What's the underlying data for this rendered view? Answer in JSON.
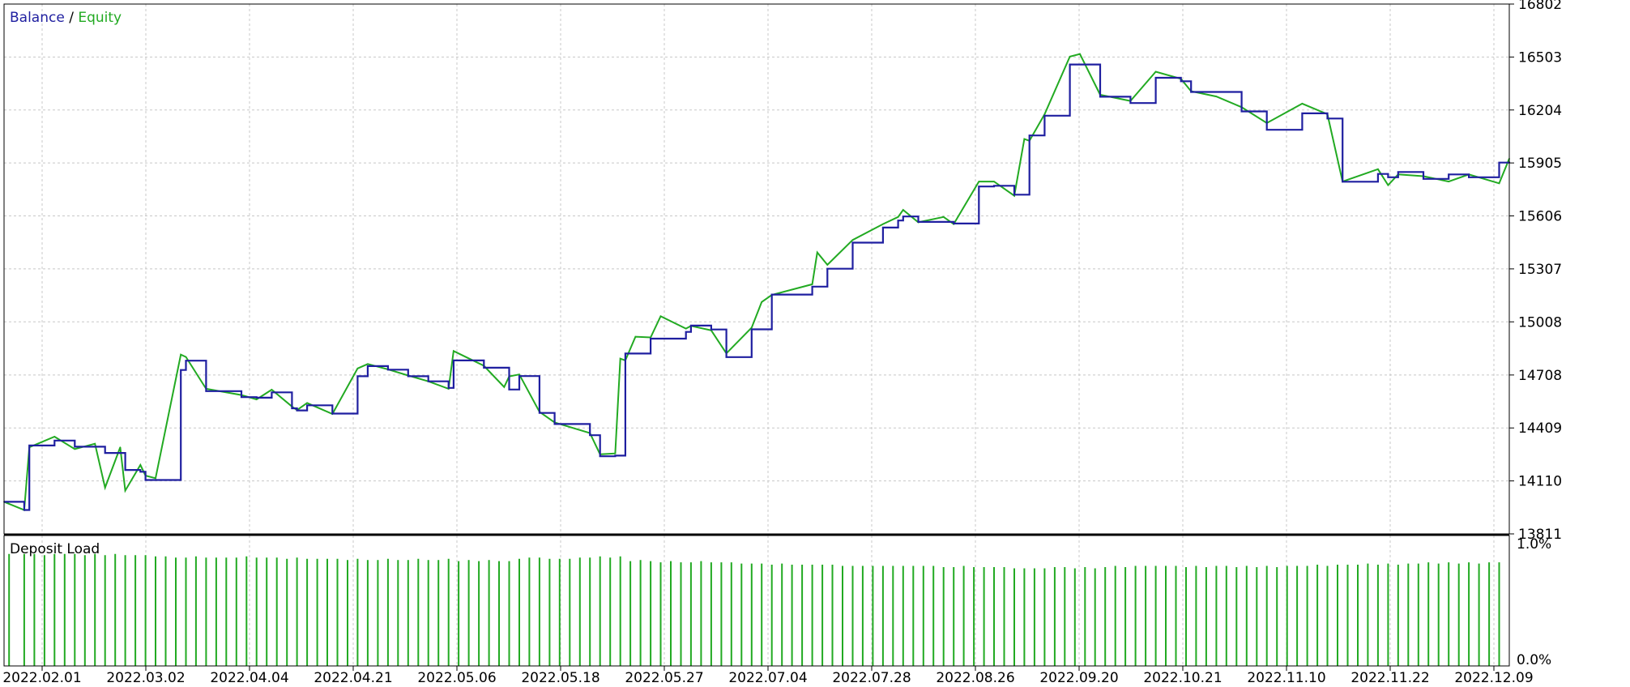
{
  "colors": {
    "balance": "#1F1FA0",
    "equity": "#22AA22",
    "load": "#22AA22",
    "grid": "#C8C8C8",
    "frame": "#000000",
    "axis_text": "#000000"
  },
  "legend": {
    "balance_label": "Balance",
    "separator": " / ",
    "equity_label": "Equity"
  },
  "chart_data": [
    {
      "type": "line",
      "xlabel": "",
      "ylabel": "",
      "ylim": [
        13811,
        16802
      ],
      "y_ticks": [
        16802,
        16503,
        16204,
        15905,
        15606,
        15307,
        15008,
        14708,
        14409,
        14110,
        13811
      ],
      "grid": true,
      "legend_placement": "top-left",
      "x_ticks": [
        "2022.02.01",
        "2022.03.02",
        "2022.04.04",
        "2022.04.21",
        "2022.05.06",
        "2022.05.18",
        "2022.05.27",
        "2022.07.04",
        "2022.07.28",
        "2022.08.26",
        "2022.09.20",
        "2022.10.21",
        "2022.11.10",
        "2022.11.22",
        "2022.12.09"
      ],
      "x_range": [
        0,
        298
      ],
      "series": [
        {
          "name": "Balance",
          "x": [
            0,
            4,
            5,
            10,
            14,
            20,
            24,
            27,
            28,
            35,
            36,
            40,
            47,
            50,
            53,
            57,
            58,
            60,
            65,
            70,
            72,
            76,
            80,
            84,
            88,
            89,
            95,
            100,
            102,
            106,
            109,
            116,
            118,
            121,
            123,
            128,
            135,
            136,
            140,
            143,
            148,
            152,
            160,
            163,
            168,
            174,
            177,
            178,
            181,
            188,
            193,
            196,
            200,
            203,
            206,
            211,
            217,
            223,
            228,
            233,
            235,
            245,
            250,
            257,
            262,
            265,
            272,
            274,
            276,
            281,
            286,
            290,
            296,
            298
          ],
          "y": [
            13992,
            13946,
            14310,
            14338,
            14303,
            14268,
            14172,
            14162,
            14115,
            14736,
            14789,
            14617,
            14583,
            14580,
            14610,
            14520,
            14508,
            14537,
            14490,
            14701,
            14758,
            14738,
            14701,
            14672,
            14635,
            14790,
            14749,
            14626,
            14702,
            14494,
            14431,
            14368,
            14249,
            14253,
            14829,
            14913,
            14951,
            14987,
            14965,
            14809,
            14966,
            15162,
            15207,
            15308,
            15455,
            15540,
            15580,
            15603,
            15572,
            15563,
            15772,
            15776,
            15726,
            16060,
            16172,
            16461,
            16279,
            16243,
            16386,
            16366,
            16306,
            16196,
            16092,
            16185,
            16156,
            15799,
            15843,
            15824,
            15854,
            15815,
            15840,
            15824,
            15907,
            15905
          ]
        },
        {
          "name": "Equity",
          "x": [
            0,
            4,
            5,
            10,
            14,
            18,
            20,
            23,
            24,
            27,
            28,
            30,
            35,
            36,
            40,
            47,
            50,
            53,
            57,
            58,
            60,
            65,
            70,
            72,
            76,
            80,
            84,
            88,
            89,
            95,
            99,
            100,
            102,
            106,
            109,
            116,
            118,
            121,
            122,
            123,
            125,
            128,
            130,
            135,
            136,
            140,
            143,
            148,
            150,
            152,
            160,
            161,
            163,
            168,
            174,
            177,
            178,
            181,
            186,
            188,
            193,
            196,
            200,
            202,
            203,
            206,
            211,
            213,
            217,
            223,
            228,
            233,
            235,
            240,
            245,
            250,
            257,
            262,
            265,
            270,
            272,
            274,
            276,
            281,
            286,
            290,
            296,
            298
          ],
          "y": [
            13992,
            13946,
            14300,
            14360,
            14290,
            14320,
            14072,
            14300,
            14055,
            14200,
            14140,
            14125,
            14823,
            14810,
            14630,
            14595,
            14570,
            14625,
            14530,
            14510,
            14550,
            14488,
            14745,
            14770,
            14740,
            14705,
            14672,
            14630,
            14843,
            14760,
            14640,
            14700,
            14711,
            14500,
            14440,
            14380,
            14260,
            14265,
            14800,
            14790,
            14924,
            14920,
            15040,
            14970,
            14985,
            14960,
            14830,
            14975,
            15120,
            15160,
            15220,
            15400,
            15330,
            15470,
            15560,
            15600,
            15640,
            15570,
            15600,
            15560,
            15800,
            15800,
            15720,
            16040,
            16030,
            16180,
            16505,
            16520,
            16290,
            16255,
            16420,
            16380,
            16310,
            16280,
            16220,
            16130,
            16240,
            16180,
            15800,
            15850,
            15870,
            15780,
            15840,
            15830,
            15800,
            15840,
            15790,
            15930
          ]
        }
      ]
    },
    {
      "type": "bar",
      "title": "Deposit Load",
      "ylim": [
        0,
        1.0
      ],
      "y_ticks": [
        "1.0%",
        "0.0%"
      ],
      "x_range": [
        0,
        298
      ],
      "series": [
        {
          "name": "Deposit Load",
          "x": [
            1,
            4,
            6,
            8,
            10,
            12,
            14,
            16,
            18,
            20,
            22,
            24,
            26,
            28,
            30,
            32,
            34,
            36,
            38,
            40,
            42,
            44,
            46,
            48,
            50,
            52,
            54,
            56,
            58,
            60,
            62,
            64,
            66,
            68,
            70,
            72,
            74,
            76,
            78,
            80,
            82,
            84,
            86,
            88,
            90,
            92,
            94,
            96,
            98,
            100,
            102,
            104,
            106,
            108,
            110,
            112,
            114,
            116,
            118,
            120,
            122,
            124,
            126,
            128,
            130,
            132,
            134,
            136,
            138,
            140,
            142,
            144,
            146,
            148,
            150,
            152,
            154,
            156,
            158,
            160,
            162,
            164,
            166,
            168,
            170,
            172,
            174,
            176,
            178,
            180,
            182,
            184,
            186,
            188,
            190,
            192,
            194,
            196,
            198,
            200,
            202,
            204,
            206,
            208,
            210,
            212,
            214,
            216,
            218,
            220,
            222,
            224,
            226,
            228,
            230,
            232,
            234,
            236,
            238,
            240,
            242,
            244,
            246,
            248,
            250,
            252,
            254,
            256,
            258,
            260,
            262,
            264,
            266,
            268,
            270,
            272,
            274,
            276,
            278,
            280,
            282,
            284,
            286,
            288,
            290,
            292,
            294,
            296
          ],
          "values": [
            0.94,
            0.94,
            0.94,
            0.93,
            0.94,
            0.94,
            0.94,
            0.93,
            0.94,
            0.93,
            0.94,
            0.93,
            0.93,
            0.93,
            0.92,
            0.92,
            0.91,
            0.91,
            0.92,
            0.91,
            0.91,
            0.91,
            0.91,
            0.92,
            0.91,
            0.91,
            0.91,
            0.9,
            0.91,
            0.9,
            0.9,
            0.9,
            0.9,
            0.89,
            0.9,
            0.89,
            0.89,
            0.9,
            0.89,
            0.89,
            0.9,
            0.89,
            0.89,
            0.9,
            0.88,
            0.89,
            0.88,
            0.89,
            0.88,
            0.88,
            0.9,
            0.91,
            0.91,
            0.9,
            0.9,
            0.9,
            0.91,
            0.91,
            0.92,
            0.91,
            0.92,
            0.88,
            0.89,
            0.88,
            0.87,
            0.88,
            0.87,
            0.87,
            0.88,
            0.87,
            0.87,
            0.87,
            0.86,
            0.86,
            0.86,
            0.85,
            0.86,
            0.85,
            0.85,
            0.85,
            0.85,
            0.85,
            0.84,
            0.84,
            0.84,
            0.84,
            0.84,
            0.84,
            0.84,
            0.84,
            0.84,
            0.84,
            0.83,
            0.83,
            0.84,
            0.83,
            0.83,
            0.83,
            0.83,
            0.82,
            0.82,
            0.82,
            0.82,
            0.83,
            0.83,
            0.82,
            0.83,
            0.82,
            0.83,
            0.84,
            0.83,
            0.84,
            0.84,
            0.84,
            0.84,
            0.84,
            0.83,
            0.84,
            0.83,
            0.84,
            0.84,
            0.83,
            0.84,
            0.83,
            0.84,
            0.83,
            0.84,
            0.84,
            0.84,
            0.85,
            0.84,
            0.85,
            0.85,
            0.85,
            0.86,
            0.85,
            0.86,
            0.85,
            0.86,
            0.86,
            0.87,
            0.86,
            0.87,
            0.86,
            0.87,
            0.86,
            0.87,
            0.87
          ]
        }
      ]
    }
  ]
}
